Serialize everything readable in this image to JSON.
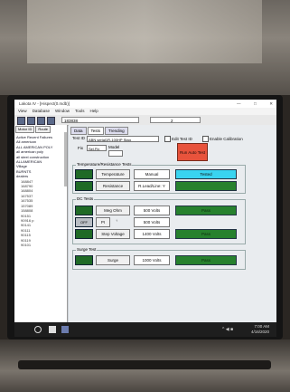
{
  "window": {
    "title": "Lakota IV - [Hispect(0.mdb)]",
    "controls": [
      "—",
      "□",
      "✕"
    ]
  },
  "menu": [
    "View",
    "Database",
    "Window",
    "Tools",
    "Help"
  ],
  "toolbar": {
    "field_value": "183838",
    "field2_value": "2"
  },
  "left": {
    "tabs": [
      "Motor ID",
      "Route"
    ],
    "tree": [
      {
        "label": "Active Recent Failures",
        "indent": false
      },
      {
        "label": "All american",
        "indent": false
      },
      {
        "label": "ALL AMERICAN POLY",
        "indent": false
      },
      {
        "label": "all american poly",
        "indent": false
      },
      {
        "label": "all steel construction",
        "indent": false
      },
      {
        "label": "ALLAMERICAN",
        "indent": false
      },
      {
        "label": "Village",
        "indent": false
      },
      {
        "label": "BURNTS",
        "indent": false
      },
      {
        "label": "dealers",
        "indent": false
      },
      {
        "label": "168847",
        "indent": true
      },
      {
        "label": "168790",
        "indent": true
      },
      {
        "label": "168804",
        "indent": true
      },
      {
        "label": "167537",
        "indent": true
      },
      {
        "label": "167535",
        "indent": true
      },
      {
        "label": "157089",
        "indent": true
      },
      {
        "label": "158808",
        "indent": true
      },
      {
        "label": "90151",
        "indent": true
      },
      {
        "label": "90916 p",
        "indent": true
      },
      {
        "label": "90141",
        "indent": true
      },
      {
        "label": "90111",
        "indent": true
      },
      {
        "label": "90115",
        "indent": true
      },
      {
        "label": "90119",
        "indent": true
      },
      {
        "label": "90101",
        "indent": true
      }
    ]
  },
  "main": {
    "tabs": [
      "Data",
      "Tests",
      "Trending"
    ],
    "test_id_label": "Test ID",
    "test_id_value": "ABN serial1R-100HP Stag",
    "edit_test_label": "Edit Test ID",
    "enable_cal_label": "Enable Calibration",
    "fix_label": "Fix",
    "fix_value": "Sel.Fix",
    "model_label": "Model",
    "run_button": "Run Auto Test",
    "groups": {
      "temp": "Temperature/Resistance Tests",
      "dc": "DC Tests",
      "surge": "Surge Test"
    },
    "temp_rows": [
      {
        "button": "Temperature",
        "value": "Manual",
        "status": "Tested",
        "status_color": "cyan"
      },
      {
        "button": "Resistance",
        "value": "R.Lead/Line: Y",
        "status": "",
        "status_color": "green"
      }
    ],
    "dc_rows": [
      {
        "button": "Meg Ohm",
        "value": "500 Volts",
        "status": "Pass",
        "status_color": "green"
      },
      {
        "button": "PI",
        "value": "500 Volts",
        "status": "",
        "status_color": "none"
      },
      {
        "button": "Step Voltage",
        "value": "1400 Volts",
        "status": "Pass",
        "status_color": "green"
      }
    ],
    "surge_rows": [
      {
        "button": "Surge",
        "value": "1000 Volts",
        "status": "Pass",
        "status_color": "green"
      }
    ],
    "off_label": "OFF",
    "dc_up": "↑"
  },
  "taskbar": {
    "time": "7:00 AM",
    "date": "4/16/2020",
    "tray": "^ ◀ ■"
  },
  "colors": {
    "pass": "#27812e",
    "tested": "#39d4f0",
    "run_button": "#e8533c"
  }
}
